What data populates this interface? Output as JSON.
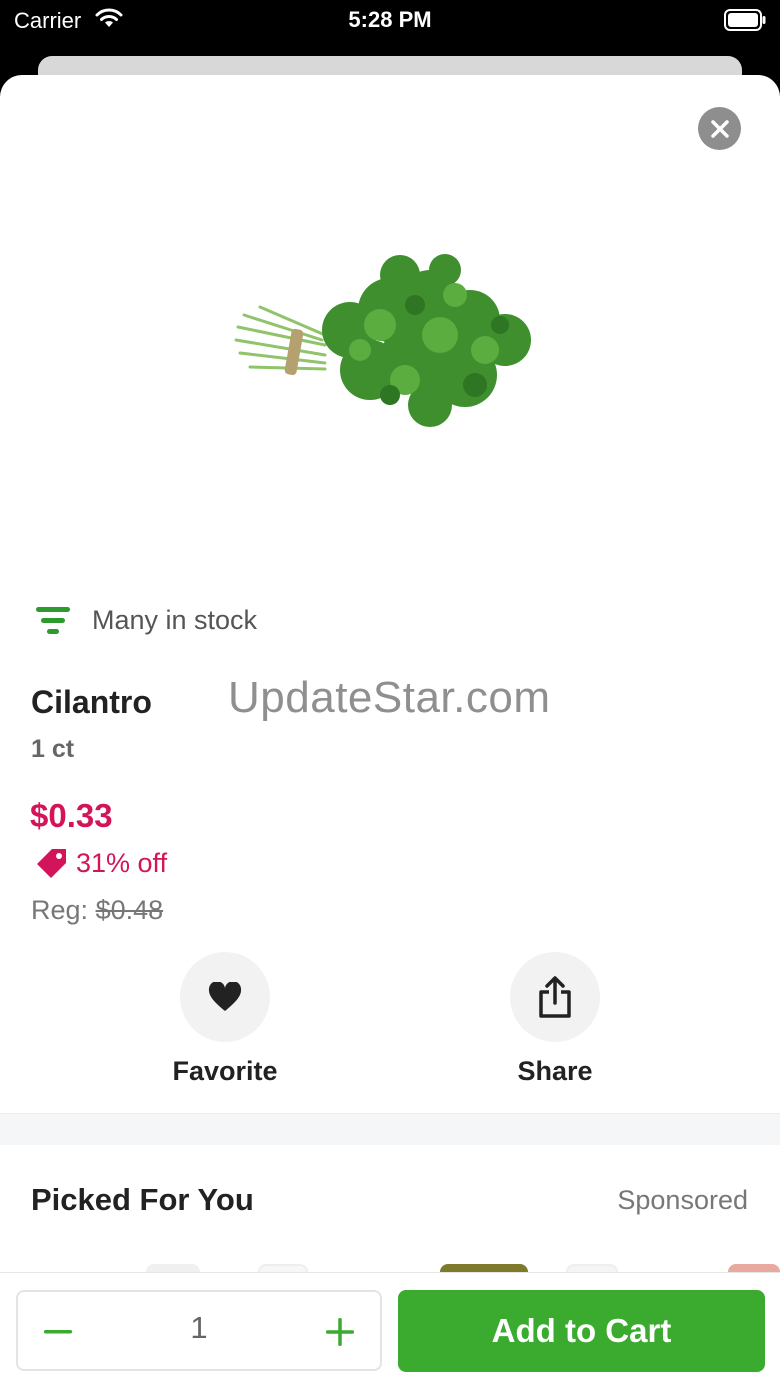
{
  "status_bar": {
    "carrier": "Carrier",
    "time": "5:28 PM"
  },
  "product": {
    "stock_label": "Many in stock",
    "name": "Cilantro",
    "size": "1 ct",
    "price": "$0.33",
    "discount": "31% off",
    "reg_label": "Reg:",
    "reg_price": "$0.48"
  },
  "watermark": "UpdateStar.com",
  "actions": {
    "favorite_label": "Favorite",
    "share_label": "Share"
  },
  "picked_section": {
    "title": "Picked For You",
    "sponsored_label": "Sponsored"
  },
  "cart": {
    "quantity": "1",
    "add_label": "Add to Cart"
  },
  "colors": {
    "accent_green": "#3aab2f",
    "price_pink": "#d4145a",
    "stock_green": "#2c9a2c"
  }
}
